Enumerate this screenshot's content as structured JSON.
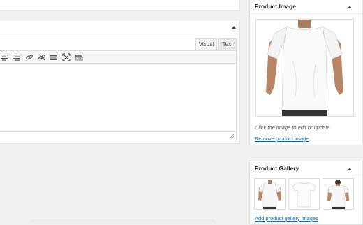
{
  "editor": {
    "tabs": {
      "visual": "Visual",
      "text": "Text"
    },
    "toolbar_icons": [
      "align-center-icon",
      "align-right-icon",
      "insert-link-icon",
      "unlink-icon",
      "read-more-icon",
      "fullscreen-icon",
      "toolbar-toggle-icon"
    ]
  },
  "product_image": {
    "title": "Product Image",
    "hint": "Click the image to edit or update",
    "remove_link": "Remove product image"
  },
  "product_gallery": {
    "title": "Product Gallery",
    "add_link": "Add product gallery images",
    "thumbnails": [
      "white-tshirt-model-front",
      "white-tshirt-plain",
      "white-tshirt-model-back"
    ]
  },
  "colors": {
    "link": "#0073aa",
    "background": "#f1f1f1",
    "title_text": "#23282d"
  }
}
